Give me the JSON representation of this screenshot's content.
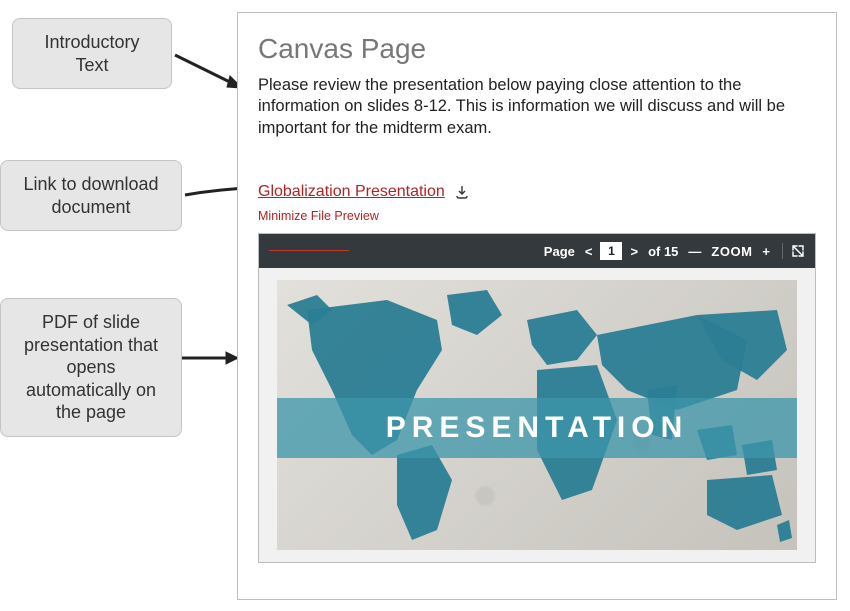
{
  "callouts": {
    "intro": "Introductory Text",
    "link": "Link to download document",
    "pdf": "PDF of slide presentation that opens automatically on the page"
  },
  "page": {
    "title": "Canvas Page",
    "intro": "Please review the presentation below paying close attention to the information on slides 8-12. This is information we will discuss and will be important for the midterm exam.",
    "doc_link_label": "Globalization Presentation",
    "minimize_label": "Minimize File Preview"
  },
  "viewer": {
    "page_label": "Page",
    "page_current": "1",
    "page_total": "of 15",
    "zoom_label": "ZOOM",
    "slide_title": "PRESENTATION"
  }
}
